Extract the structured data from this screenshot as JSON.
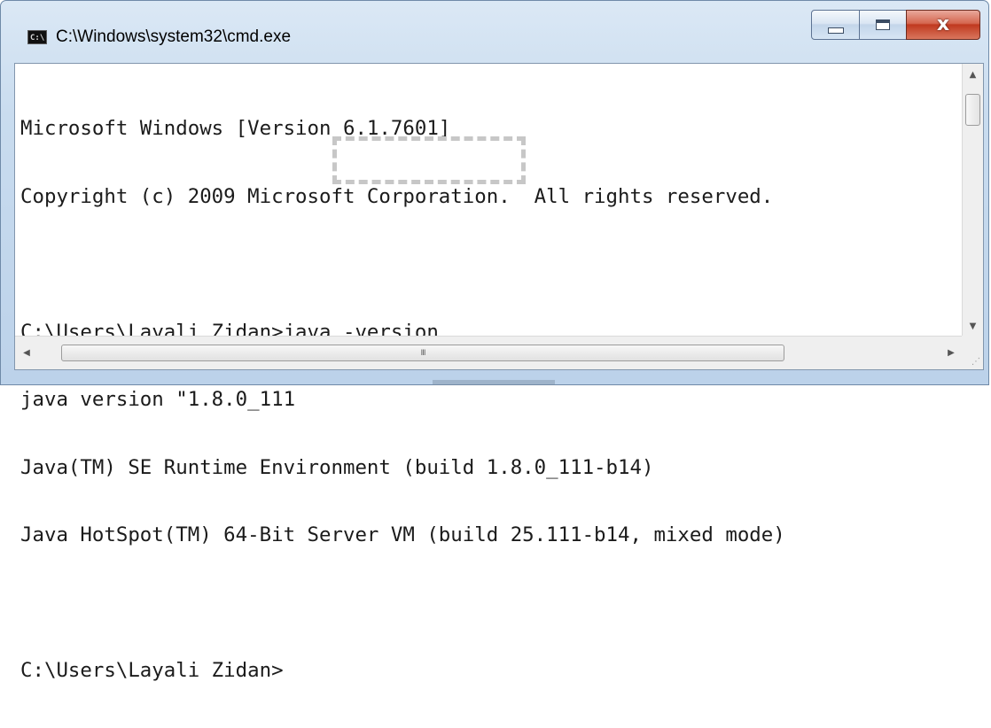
{
  "window": {
    "title": "C:\\Windows\\system32\\cmd.exe",
    "icon": "cmd-icon",
    "icon_text": "C:\\",
    "controls": {
      "minimize_icon": "minimize-icon",
      "maximize_icon": "maximize-icon",
      "close_glyph": "x",
      "close_icon": "close-icon"
    }
  },
  "console": {
    "lines": [
      "Microsoft Windows [Version 6.1.7601]",
      "Copyright (c) 2009 Microsoft Corporation.  All rights reserved.",
      "",
      "C:\\Users\\Layali Zidan>java -version",
      "java version \"1.8.0_111",
      "Java(TM) SE Runtime Environment (build 1.8.0_111-b14)",
      "Java HotSpot(TM) 64-Bit Server VM (build 25.111-b14, mixed mode)",
      "",
      "C:\\Users\\Layali Zidan>"
    ],
    "highlighted_command": "java -version"
  },
  "scrollbars": {
    "up_arrow": "▲",
    "down_arrow": "▼",
    "left_arrow": "◀",
    "right_arrow": "▶",
    "grip": "III",
    "size_grip": "⋰"
  },
  "colors": {
    "titlebar": "#c9dcef",
    "close_button": "#c0391f",
    "console_bg": "#ffffff",
    "console_text": "#1b1b1b",
    "highlight_border": "#c7c7c7"
  }
}
